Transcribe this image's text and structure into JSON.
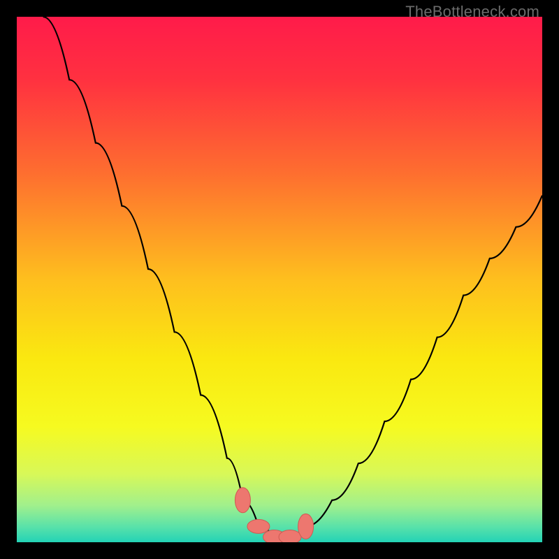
{
  "watermark": "TheBottleneck.com",
  "colors": {
    "background_frame": "#000000",
    "curve": "#000000",
    "marker_fill": "#ED776F",
    "marker_stroke": "#CF5A53",
    "gradient_stops": [
      {
        "offset": 0.0,
        "color": "#FF1B4A"
      },
      {
        "offset": 0.12,
        "color": "#FF3140"
      },
      {
        "offset": 0.3,
        "color": "#FE6F2F"
      },
      {
        "offset": 0.5,
        "color": "#FEBF1E"
      },
      {
        "offset": 0.65,
        "color": "#FAE810"
      },
      {
        "offset": 0.78,
        "color": "#F6FA20"
      },
      {
        "offset": 0.87,
        "color": "#D8F858"
      },
      {
        "offset": 0.93,
        "color": "#A1F08C"
      },
      {
        "offset": 0.97,
        "color": "#5AE2A9"
      },
      {
        "offset": 1.0,
        "color": "#23D3B6"
      }
    ]
  },
  "chart_data": {
    "type": "line",
    "title": "",
    "xlabel": "",
    "ylabel": "",
    "xlim": [
      0,
      100
    ],
    "ylim": [
      0,
      100
    ],
    "series": [
      {
        "name": "bottleneck-curve",
        "x": [
          5,
          10,
          15,
          20,
          25,
          30,
          35,
          40,
          43,
          46,
          49,
          52,
          55,
          60,
          65,
          70,
          75,
          80,
          85,
          90,
          95,
          100
        ],
        "values": [
          100,
          88,
          76,
          64,
          52,
          40,
          28,
          16,
          8,
          3,
          1,
          1,
          3,
          8,
          15,
          23,
          31,
          39,
          47,
          54,
          60,
          66
        ]
      }
    ],
    "markers": {
      "name": "highlighted-range",
      "x": [
        43,
        46,
        49,
        52,
        55
      ],
      "values": [
        8,
        3,
        1,
        1,
        3
      ]
    },
    "annotations": []
  }
}
